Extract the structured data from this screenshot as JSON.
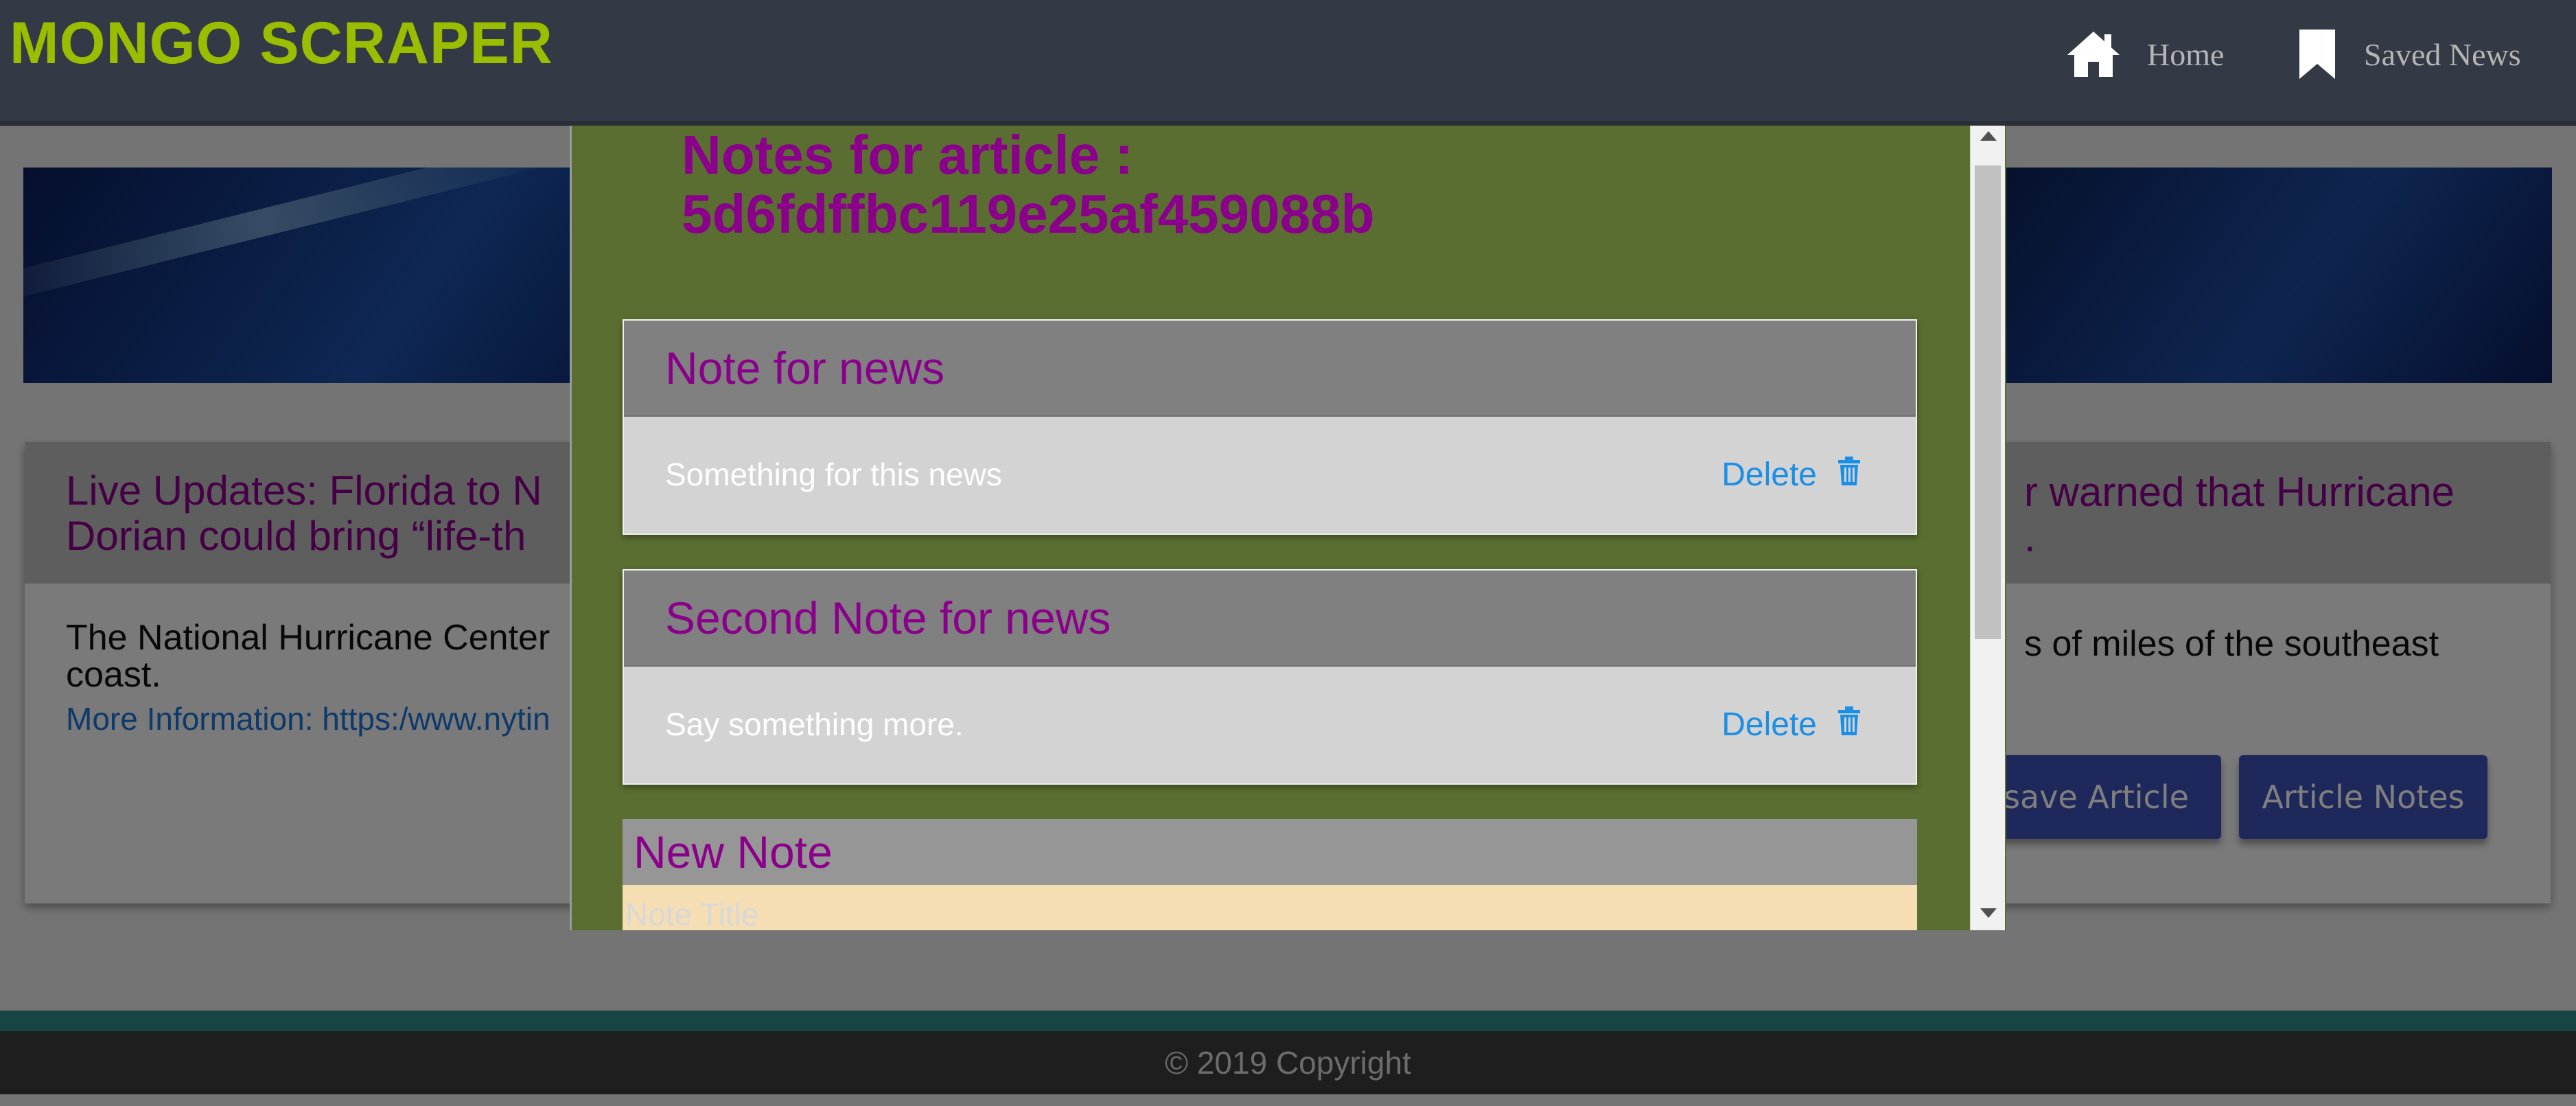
{
  "navbar": {
    "brand": "MONGO SCRAPER",
    "links": [
      {
        "label": "Home",
        "icon": "home-icon"
      },
      {
        "label": "Saved News",
        "icon": "bookmark-icon"
      }
    ]
  },
  "article": {
    "title_left": "Live Updates: Florida to N",
    "title_left_line2": "Dorian could bring “life-th",
    "title_right": "r warned that Hurricane",
    "title_right_line2": ".",
    "summary_left": "The National Hurricane Center",
    "summary_left_line2": "coast.",
    "summary_right": "s of miles of the southeast",
    "more_info": "More Information: https:/www.nytin",
    "buttons": {
      "save": "save Article",
      "notes": "Article Notes"
    }
  },
  "footer": {
    "copyright": "© 2019 Copyright"
  },
  "modal": {
    "title_line1": "Notes for article :",
    "title_line2": "5d6fdffbc119e25af459088b",
    "notes": [
      {
        "title": "Note for news",
        "body": "Something for this news",
        "delete_label": "Delete"
      },
      {
        "title": "Second Note for news",
        "body": "Say something more.",
        "delete_label": "Delete"
      }
    ],
    "new_note": {
      "heading": "New Note",
      "title_placeholder": "Note Title"
    }
  },
  "colors": {
    "navbar": "#343a45",
    "brand": "#9abd00",
    "modal_bg": "#5a6e31",
    "title_purple": "#8b008b",
    "button_blue": "#3f51b5",
    "delete_blue": "#1a8fe6",
    "input_bg": "#f5deb3"
  }
}
